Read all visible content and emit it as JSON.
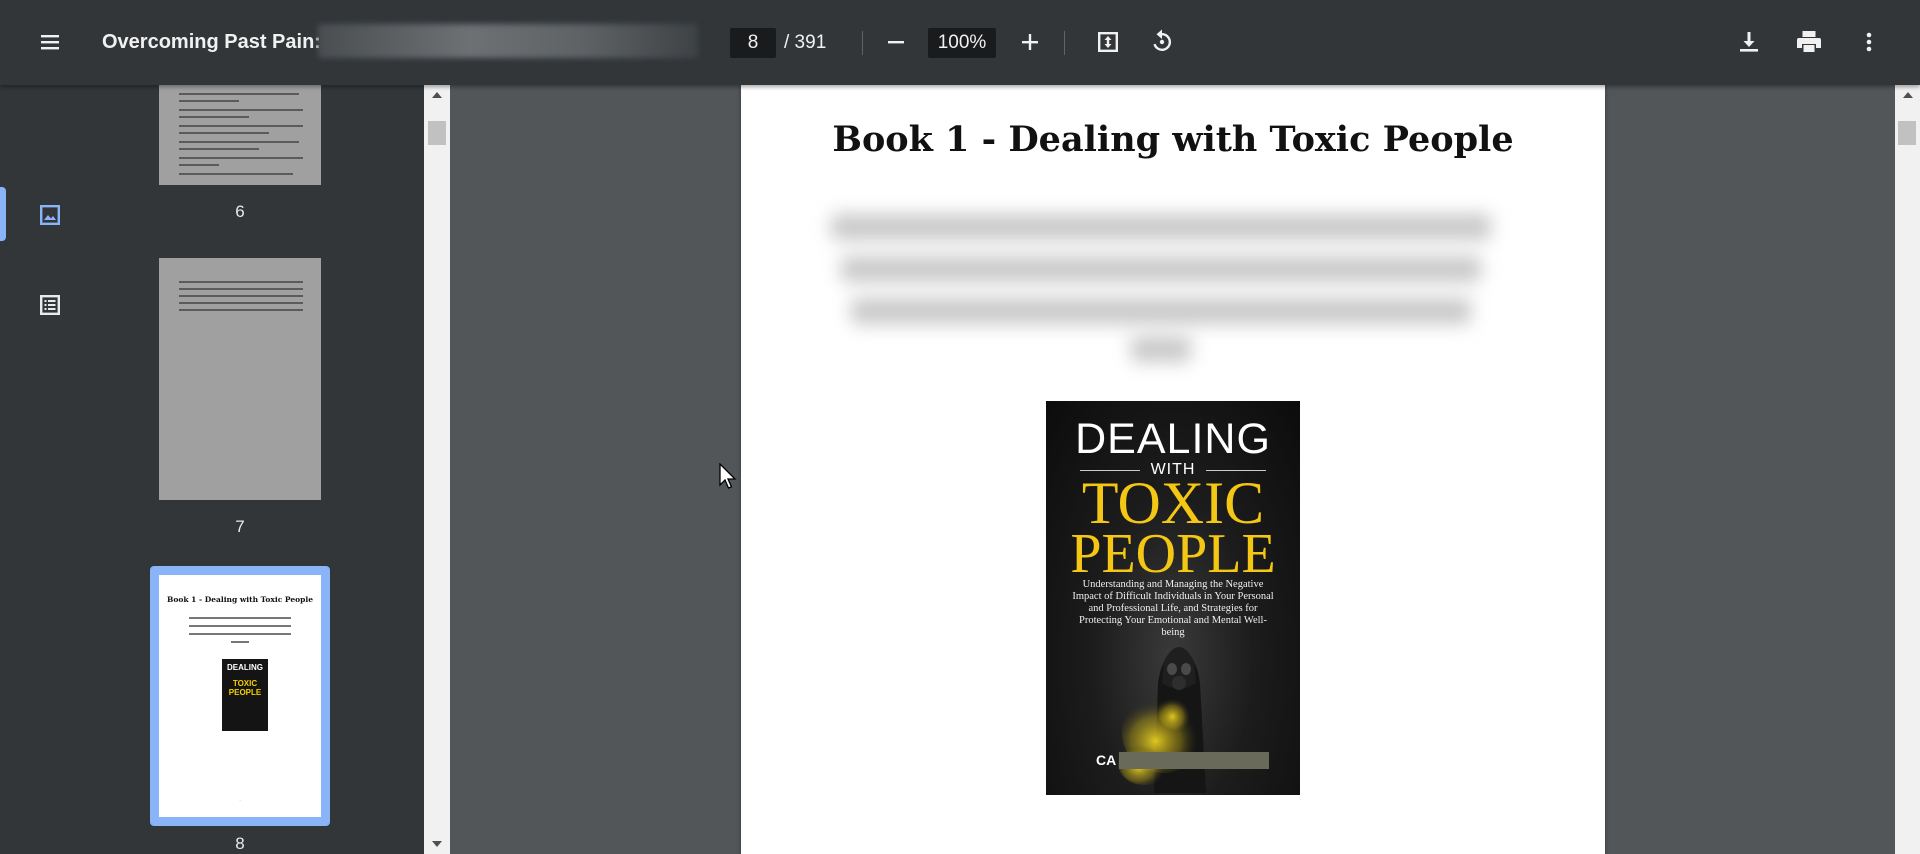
{
  "toolbar": {
    "title": "Overcoming Past Pain: I",
    "current_page": "8",
    "page_total": "/ 391",
    "zoom": "100%"
  },
  "thumbnails": [
    {
      "label": "6"
    },
    {
      "label": "7"
    },
    {
      "label": "8",
      "selected": true,
      "title": "Book 1 - Dealing with Toxic People",
      "cover_line1": "DEALING",
      "cover_line2": "TOXIC",
      "cover_line3": "PEOPLE"
    }
  ],
  "page": {
    "heading": "Book 1 - Dealing with Toxic People"
  },
  "cover": {
    "line1": "DEALING",
    "line2": "WITH",
    "line3": "TOXIC",
    "line4": "PEOPLE",
    "description": "Understanding and Managing the Negative Impact of Difficult Individuals in Your Personal and Professional Life, and Strategies for Protecting Your Emotional and Mental Well-being",
    "author_visible": "CA",
    "accent_color": "#f3c714"
  },
  "colors": {
    "toolbar_bg": "#323639",
    "viewer_bg": "#525659",
    "selection": "#8ab4f8"
  }
}
